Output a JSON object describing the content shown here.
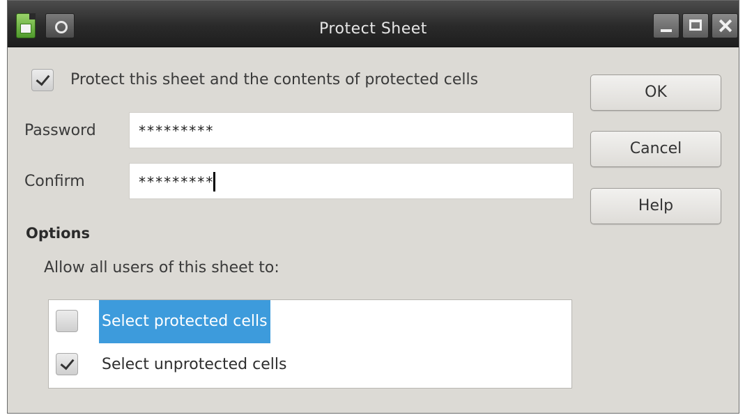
{
  "window": {
    "title": "Protect Sheet"
  },
  "protect_checkbox": {
    "label": "Protect this sheet and the contents of protected cells",
    "checked": true
  },
  "password": {
    "label": "Password",
    "value": "*********"
  },
  "confirm": {
    "label": "Confirm",
    "value": "*********"
  },
  "buttons": {
    "ok": "OK",
    "cancel": "Cancel",
    "help": "Help"
  },
  "options": {
    "heading": "Options",
    "allow_label": "Allow all users of this sheet to:",
    "items": [
      {
        "label": "Select protected cells",
        "checked": false,
        "selected": true
      },
      {
        "label": "Select unprotected cells",
        "checked": true,
        "selected": false
      }
    ]
  },
  "colors": {
    "selection": "#3d9bdc",
    "dialog_bg": "#dcdad5",
    "titlebar": "#2a2a2a"
  }
}
